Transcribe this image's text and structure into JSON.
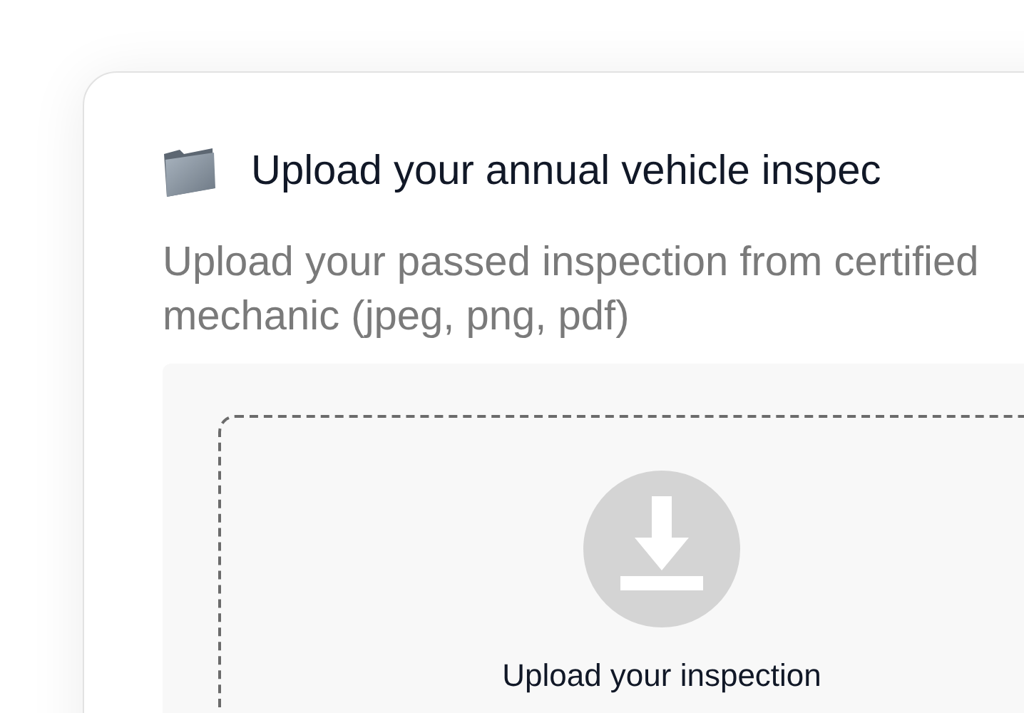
{
  "card": {
    "title": "Upload your annual vehicle inspec",
    "subtitle": "Upload your passed inspection from certified mechanic (jpeg, png, pdf)",
    "dropzone": {
      "label": "Upload your inspection"
    }
  }
}
